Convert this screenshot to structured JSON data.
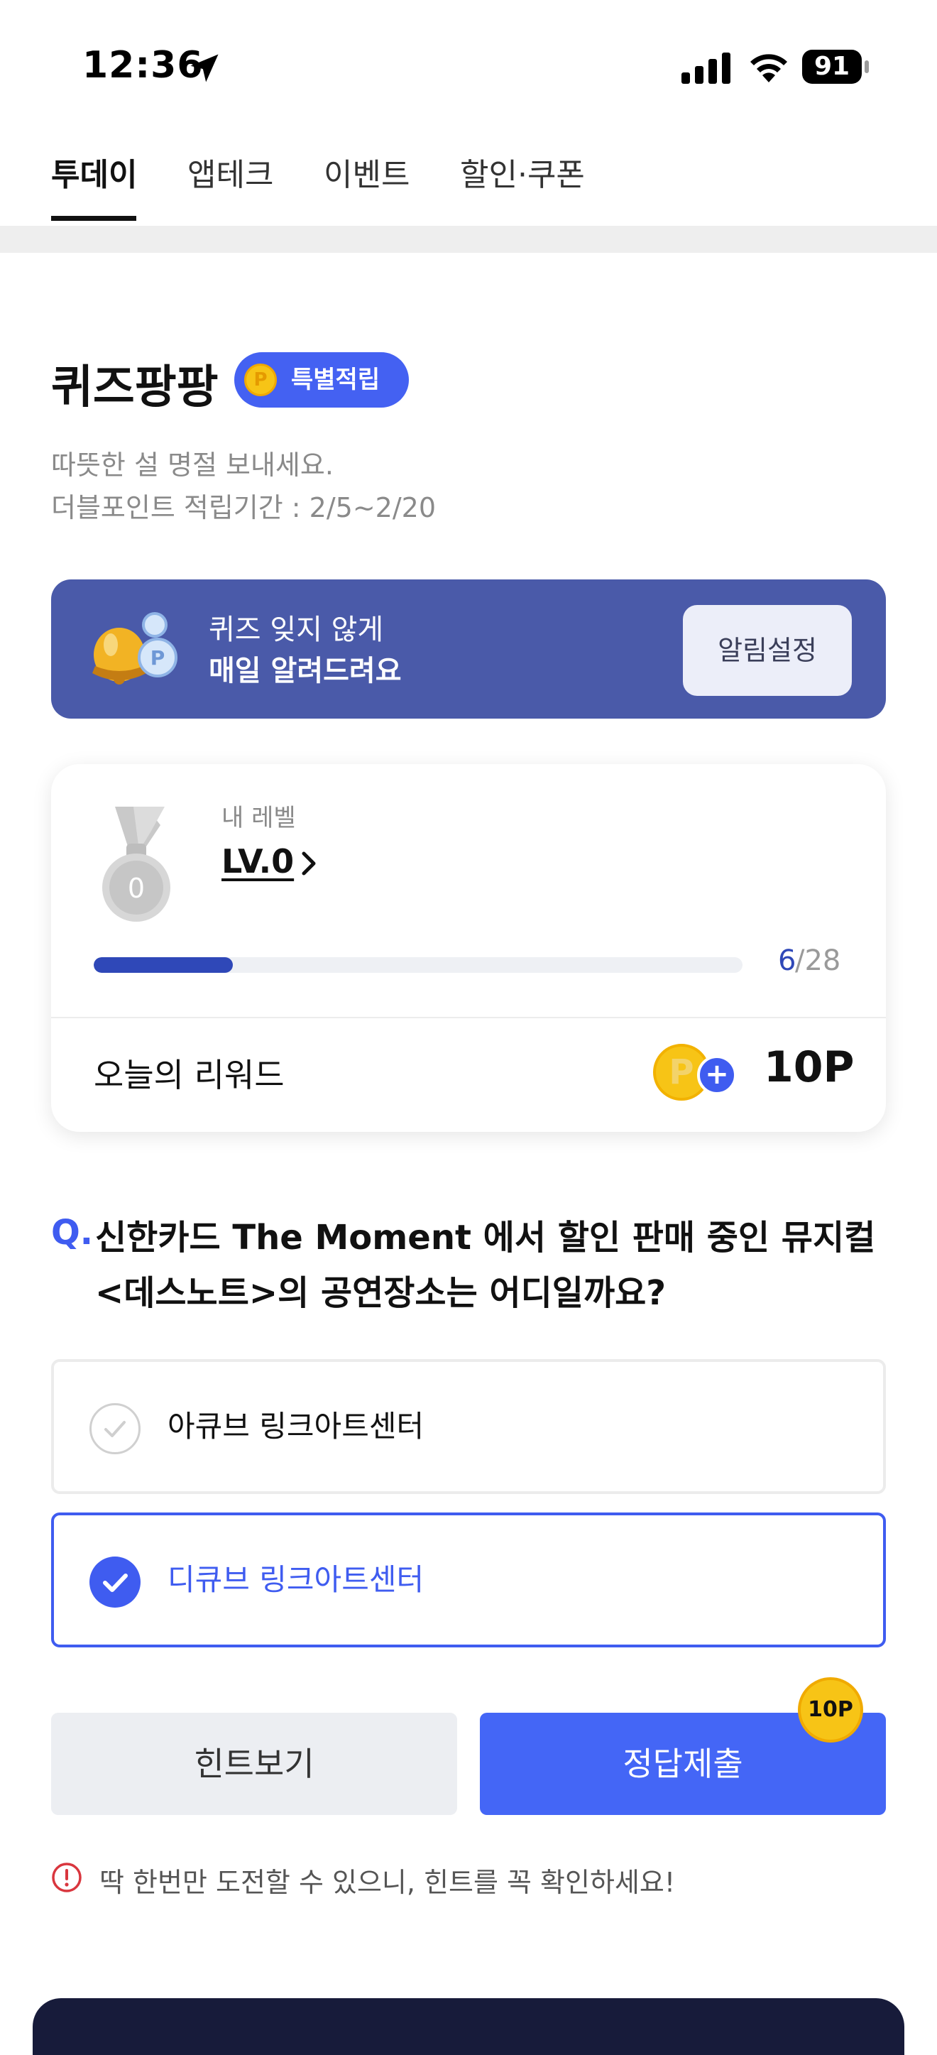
{
  "status_bar": {
    "time": "12:36",
    "battery": "91"
  },
  "tabs": [
    {
      "label": "투데이",
      "active": true
    },
    {
      "label": "앱테크",
      "active": false
    },
    {
      "label": "이벤트",
      "active": false
    },
    {
      "label": "할인·쿠폰",
      "active": false
    }
  ],
  "quiz": {
    "title": "퀴즈팡팡",
    "badge_coin": "P",
    "badge_label": "특별적립",
    "subtitle_1": "따뜻한 설 명절 보내세요.",
    "subtitle_2": "더블포인트 적립기간 : 2/5~2/20"
  },
  "banner": {
    "line1": "퀴즈 잊지 않게",
    "line2": "매일 알려드려요",
    "button": "알림설정"
  },
  "level_card": {
    "medal_number": "0",
    "label": "내 레벨",
    "level": "LV.0",
    "progress_current": "6",
    "progress_total": "/28",
    "progress_fraction": 0.214,
    "reward_label": "오늘의 리워드",
    "reward_coin": "P",
    "reward_plus": "+",
    "reward_value": "10P"
  },
  "question": {
    "marker": "Q.",
    "text": "신한카드 The Moment 에서 할인 판매 중인 뮤지컬 <데스노트>의 공연장소는 어디일까요?"
  },
  "options": [
    {
      "label": "아큐브 링크아트센터",
      "selected": false
    },
    {
      "label": "디큐브 링크아트센터",
      "selected": true
    }
  ],
  "actions": {
    "hint": "힌트보기",
    "submit": "정답제출",
    "submit_badge": "10P"
  },
  "warning": "딱 한번만 도전할 수 있으니, 힌트를 꼭 확인하세요!",
  "colors": {
    "accent": "#4466f6",
    "banner": "#4a5aa9",
    "progress": "#2f48b8",
    "coin": "#f7c416"
  }
}
